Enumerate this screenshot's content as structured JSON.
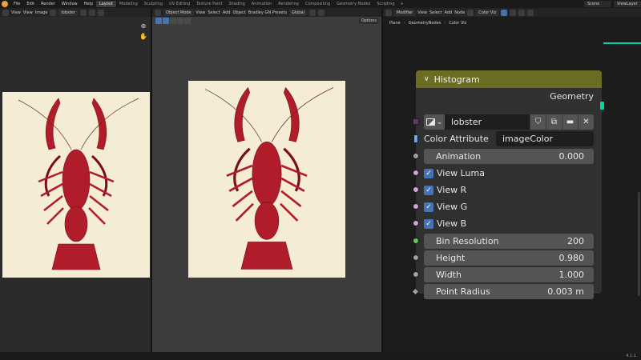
{
  "topbar": {
    "menus": [
      "File",
      "Edit",
      "Render",
      "Window",
      "Help"
    ],
    "workspaces": [
      "Layout",
      "Modeling",
      "Sculpting",
      "UV Editing",
      "Texture Paint",
      "Shading",
      "Animation",
      "Rendering",
      "Compositing",
      "Geometry Nodes",
      "Scripting"
    ],
    "active_workspace": "Layout",
    "add_tab": "+",
    "scene": "Scene",
    "view_layer": "ViewLayer"
  },
  "image_editor": {
    "menus": [
      "View",
      "View",
      "Image"
    ],
    "image_name": "lobster"
  },
  "viewport": {
    "mode": "Object Mode",
    "menus": [
      "View",
      "Select",
      "Add",
      "Object",
      "Bradley GN Presets"
    ],
    "orientation": "Global",
    "options": "Options"
  },
  "node_editor": {
    "editor_type": "Modifier",
    "menus": [
      "View",
      "Select",
      "Add",
      "Node"
    ],
    "tree_name": "Color Viz",
    "breadcrumb": [
      "Plane",
      "GeometryNodes",
      "Color Viz"
    ],
    "breadcrumb_sep": "›"
  },
  "node": {
    "title": "Histogram",
    "collapse_glyph": "∨",
    "output_label": "Geometry",
    "image": {
      "name": "lobster",
      "dropdown_glyph": "⌄",
      "fake_user_glyph": "⛉",
      "duplicate_glyph": "⧉",
      "browse_glyph": "▬",
      "close_glyph": "✕"
    },
    "color_attribute": {
      "label": "Color Attribute",
      "value": "imageColor"
    },
    "animation": {
      "label": "Animation",
      "value": "0.000"
    },
    "checkboxes": [
      {
        "label": "View Luma",
        "checked": true
      },
      {
        "label": "View R",
        "checked": true
      },
      {
        "label": "View G",
        "checked": true
      },
      {
        "label": "View B",
        "checked": true
      }
    ],
    "check_glyph": "✓",
    "bin_resolution": {
      "label": "Bin Resolution",
      "value": "200"
    },
    "height": {
      "label": "Height",
      "value": "0.980"
    },
    "width": {
      "label": "Width",
      "value": "1.000"
    },
    "point_radius": {
      "label": "Point Radius",
      "value": "0.003 m"
    }
  },
  "statusbar": {
    "version": "4.1.1"
  },
  "colors": {
    "node_header": "#6c6d23",
    "geometry_socket": "#00d6a3",
    "checkbox": "#4772b3",
    "lobster": "#b01c2a",
    "background_paper": "#f4ecd4"
  }
}
